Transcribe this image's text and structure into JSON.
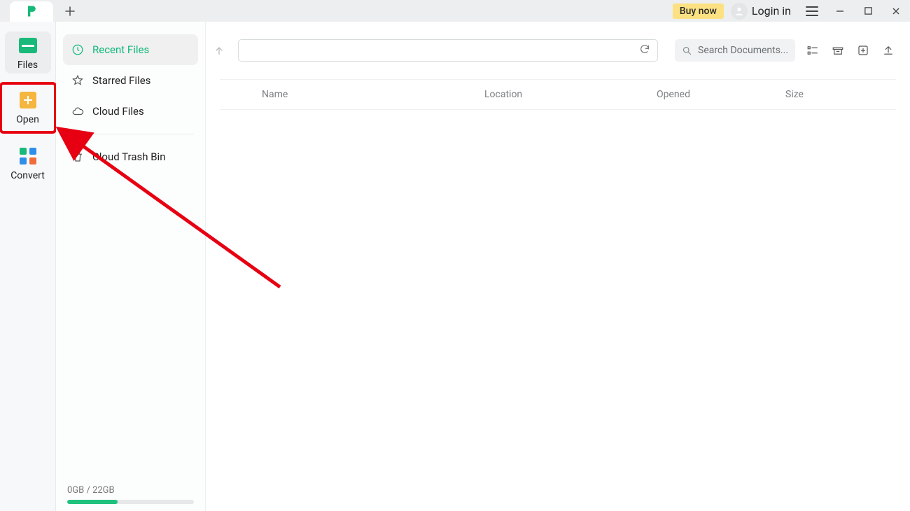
{
  "titlebar": {
    "buy_label": "Buy now",
    "login_label": "Login in"
  },
  "rail": {
    "items": [
      {
        "label": "Files"
      },
      {
        "label": "Open"
      },
      {
        "label": "Convert"
      }
    ]
  },
  "nav": {
    "items": [
      {
        "label": "Recent Files"
      },
      {
        "label": "Starred Files"
      },
      {
        "label": "Cloud Files"
      },
      {
        "label": "Cloud Trash Bin"
      }
    ]
  },
  "storage": {
    "text": "0GB / 22GB"
  },
  "toolbar": {
    "search_placeholder": "Search Documents..."
  },
  "columns": {
    "name": "Name",
    "location": "Location",
    "opened": "Opened",
    "size": "Size"
  }
}
